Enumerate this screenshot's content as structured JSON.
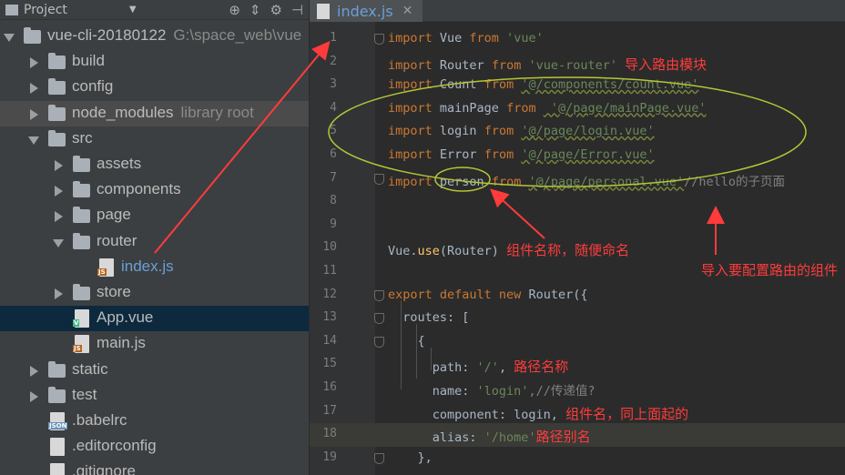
{
  "project_panel": {
    "title": "Project",
    "rows": [
      {
        "label": "vue-cli-20180122",
        "extra": "G:\\space_web\\vue",
        "kind": "folder",
        "state": "open",
        "depth": 0
      },
      {
        "label": "build",
        "kind": "folder",
        "state": "closed",
        "depth": 1
      },
      {
        "label": "config",
        "kind": "folder",
        "state": "closed",
        "depth": 1
      },
      {
        "label": "node_modules",
        "extra": "library root",
        "kind": "folder",
        "state": "closed",
        "depth": 1,
        "highlight": true
      },
      {
        "label": "src",
        "kind": "folder",
        "state": "open",
        "depth": 1
      },
      {
        "label": "assets",
        "kind": "folder",
        "state": "closed",
        "depth": 2
      },
      {
        "label": "components",
        "kind": "folder",
        "state": "closed",
        "depth": 2
      },
      {
        "label": "page",
        "kind": "folder",
        "state": "closed",
        "depth": 2
      },
      {
        "label": "router",
        "kind": "folder",
        "state": "open",
        "depth": 2
      },
      {
        "label": "index.js",
        "kind": "js",
        "depth": 3,
        "active": true
      },
      {
        "label": "store",
        "kind": "folder",
        "state": "closed",
        "depth": 2
      },
      {
        "label": "App.vue",
        "kind": "vue",
        "depth": 2,
        "selected": true
      },
      {
        "label": "main.js",
        "kind": "js",
        "depth": 2
      },
      {
        "label": "static",
        "kind": "folder",
        "state": "closed",
        "depth": 1
      },
      {
        "label": "test",
        "kind": "folder",
        "state": "closed",
        "depth": 1
      },
      {
        "label": ".babelrc",
        "kind": "json",
        "depth": 1
      },
      {
        "label": ".editorconfig",
        "kind": "cfg",
        "depth": 1
      },
      {
        "label": ".gitignore",
        "kind": "cfg",
        "depth": 1
      }
    ]
  },
  "editor": {
    "tab_label": "index.js",
    "lines": [
      {
        "n": "1",
        "t": [
          [
            "kw",
            "import "
          ],
          [
            "",
            "Vue "
          ],
          [
            "kw",
            "from "
          ],
          [
            "str",
            "'vue'"
          ]
        ]
      },
      {
        "n": "2",
        "t": [
          [
            "kw",
            "import "
          ],
          [
            "",
            "Router "
          ],
          [
            "kw",
            "from "
          ],
          [
            "str",
            "'vue-router' "
          ],
          [
            "ann",
            "导入路由模块"
          ]
        ]
      },
      {
        "n": "3",
        "t": [
          [
            "kw",
            "import "
          ],
          [
            "",
            "Count "
          ],
          [
            "kw",
            "from "
          ],
          [
            "str uline",
            "'@/components/count.vue'"
          ]
        ]
      },
      {
        "n": "4",
        "t": [
          [
            "kw",
            "import "
          ],
          [
            "",
            "mainPage "
          ],
          [
            "kw",
            "from "
          ],
          [
            "str uline",
            " '@/page/mainPage.vue'"
          ]
        ]
      },
      {
        "n": "5",
        "t": [
          [
            "kw",
            "import "
          ],
          [
            "",
            "login "
          ],
          [
            "kw",
            "from "
          ],
          [
            "str uline",
            "'@/page/login.vue'"
          ]
        ]
      },
      {
        "n": "6",
        "t": [
          [
            "kw",
            "import "
          ],
          [
            "",
            "Error "
          ],
          [
            "kw",
            "from "
          ],
          [
            "str uline",
            "'@/page/Error.vue'"
          ]
        ]
      },
      {
        "n": "7",
        "t": [
          [
            "kw",
            "import "
          ],
          [
            "",
            "person "
          ],
          [
            "kw",
            "from "
          ],
          [
            "str uline",
            "'@/page/personal.vue'"
          ],
          [
            "cm",
            "//hello的子页面"
          ]
        ]
      },
      {
        "n": "8",
        "t": []
      },
      {
        "n": "9",
        "t": []
      },
      {
        "n": "10",
        "t": [
          [
            "",
            "Vue."
          ],
          [
            "fn",
            "use"
          ],
          [
            "",
            "(Router) "
          ],
          [
            "ann",
            "组件名称，随便命名"
          ]
        ]
      },
      {
        "n": "11",
        "t": []
      },
      {
        "n": "12",
        "t": [
          [
            "kw",
            "export default new "
          ],
          [
            "",
            "Router({"
          ]
        ]
      },
      {
        "n": "13",
        "t": [
          [
            "",
            "  routes: ["
          ]
        ]
      },
      {
        "n": "14",
        "t": [
          [
            "",
            "    {"
          ]
        ]
      },
      {
        "n": "15",
        "t": [
          [
            "",
            "      path: "
          ],
          [
            "str",
            "'/'"
          ],
          [
            "",
            ", "
          ],
          [
            "ann",
            "路径名称"
          ]
        ]
      },
      {
        "n": "16",
        "t": [
          [
            "",
            "      name: "
          ],
          [
            "str",
            "'login'"
          ],
          [
            "cm",
            ",//传递值?"
          ]
        ]
      },
      {
        "n": "17",
        "t": [
          [
            "",
            "      component: login, "
          ],
          [
            "ann",
            "组件名，同上面起的"
          ]
        ]
      },
      {
        "n": "18",
        "t": [
          [
            "",
            "      alias: "
          ],
          [
            "str",
            "'/home'"
          ],
          [
            "ann",
            "路径别名"
          ]
        ],
        "current": true
      },
      {
        "n": "19",
        "t": [
          [
            "",
            "    },"
          ]
        ]
      }
    ]
  },
  "annotations": {
    "right_note": "导入要配置路由的组件"
  },
  "colors": {
    "accent_red": "#ff3b3b",
    "ellipse_green": "#b5c636"
  }
}
